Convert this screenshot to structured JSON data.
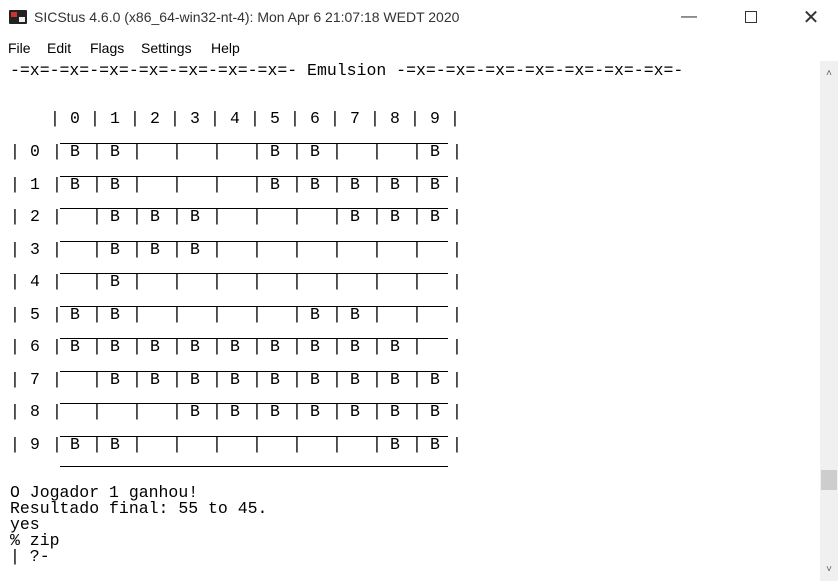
{
  "window": {
    "title": "SICStus 4.6.0 (x86_64-win32-nt-4): Mon Apr  6 21:07:18 WEDT 2020",
    "minimize_icon": "minimize-icon",
    "maximize_icon": "maximize-icon",
    "close_icon": "close-icon"
  },
  "menu": [
    {
      "label": "File"
    },
    {
      "label": "Edit"
    },
    {
      "label": "Flags"
    },
    {
      "label": "Settings"
    },
    {
      "label": "Help"
    }
  ],
  "console": {
    "banner": "-=x=-=x=-=x=-=x=-=x=-=x=-=x=- Emulsion -=x=-=x=-=x=-=x=-=x=-=x=-=x=-",
    "column_headers": [
      "0",
      "1",
      "2",
      "3",
      "4",
      "5",
      "6",
      "7",
      "8",
      "9"
    ],
    "row_labels": [
      "0",
      "1",
      "2",
      "3",
      "4",
      "5",
      "6",
      "7",
      "8",
      "9"
    ],
    "board": [
      [
        "B",
        "B",
        "",
        "",
        "",
        "B",
        "B",
        "",
        "",
        "B"
      ],
      [
        "B",
        "B",
        "",
        "",
        "",
        "B",
        "B",
        "B",
        "B",
        "B"
      ],
      [
        "",
        "B",
        "B",
        "B",
        "",
        "",
        "",
        "B",
        "B",
        "B"
      ],
      [
        "",
        "B",
        "B",
        "B",
        "",
        "",
        "",
        "",
        "",
        ""
      ],
      [
        "",
        "B",
        "",
        "",
        "",
        "",
        "",
        "",
        "",
        ""
      ],
      [
        "B",
        "B",
        "",
        "",
        "",
        "",
        "B",
        "B",
        "",
        ""
      ],
      [
        "B",
        "B",
        "B",
        "B",
        "B",
        "B",
        "B",
        "B",
        "B",
        ""
      ],
      [
        "",
        "B",
        "B",
        "B",
        "B",
        "B",
        "B",
        "B",
        "B",
        "B"
      ],
      [
        "",
        "",
        "",
        "B",
        "B",
        "B",
        "B",
        "B",
        "B",
        "B"
      ],
      [
        "B",
        "B",
        "",
        "",
        "",
        "",
        "",
        "",
        "B",
        "B"
      ]
    ],
    "output_lines": [
      "O Jogador 1 ganhou!",
      "Resultado final: 55 to 45.",
      "yes",
      "% zip",
      "| ?-"
    ]
  },
  "scrollbar": {
    "up_icon": "arrow-up-icon",
    "down_icon": "arrow-down-icon"
  }
}
